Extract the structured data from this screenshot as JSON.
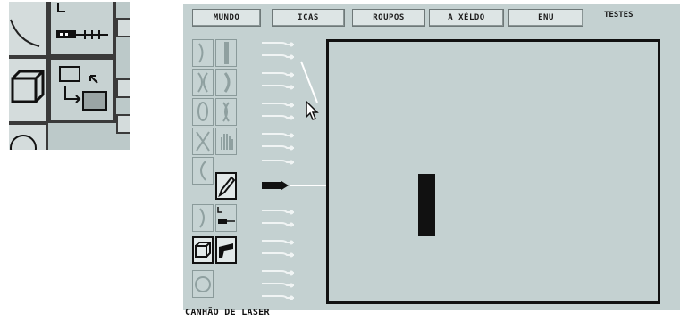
{
  "menu": {
    "items": [
      {
        "id": "menu-mundo",
        "label": "MUNDO"
      },
      {
        "id": "menu-icas",
        "label": "ICAS"
      },
      {
        "id": "menu-roupos",
        "label": "ROUPOS"
      },
      {
        "id": "menu-a-xelos",
        "label": "A XÉLDO"
      },
      {
        "id": "menu-enu",
        "label": "ENU"
      }
    ],
    "right_label": "TESTES"
  },
  "status": {
    "tool_name": "CANHÃO DE LASER"
  },
  "icons": {
    "selected_tool": "pencil-icon",
    "laser": "laser-cannon-icon",
    "box": "box-icon",
    "swap": "swap-arrow-icon",
    "cursor": "arrow-cursor-icon"
  },
  "colors": {
    "screen_bg": "#c4d1d1",
    "board_border": "#111111",
    "beam": "#ffffff",
    "block": "#111111"
  }
}
